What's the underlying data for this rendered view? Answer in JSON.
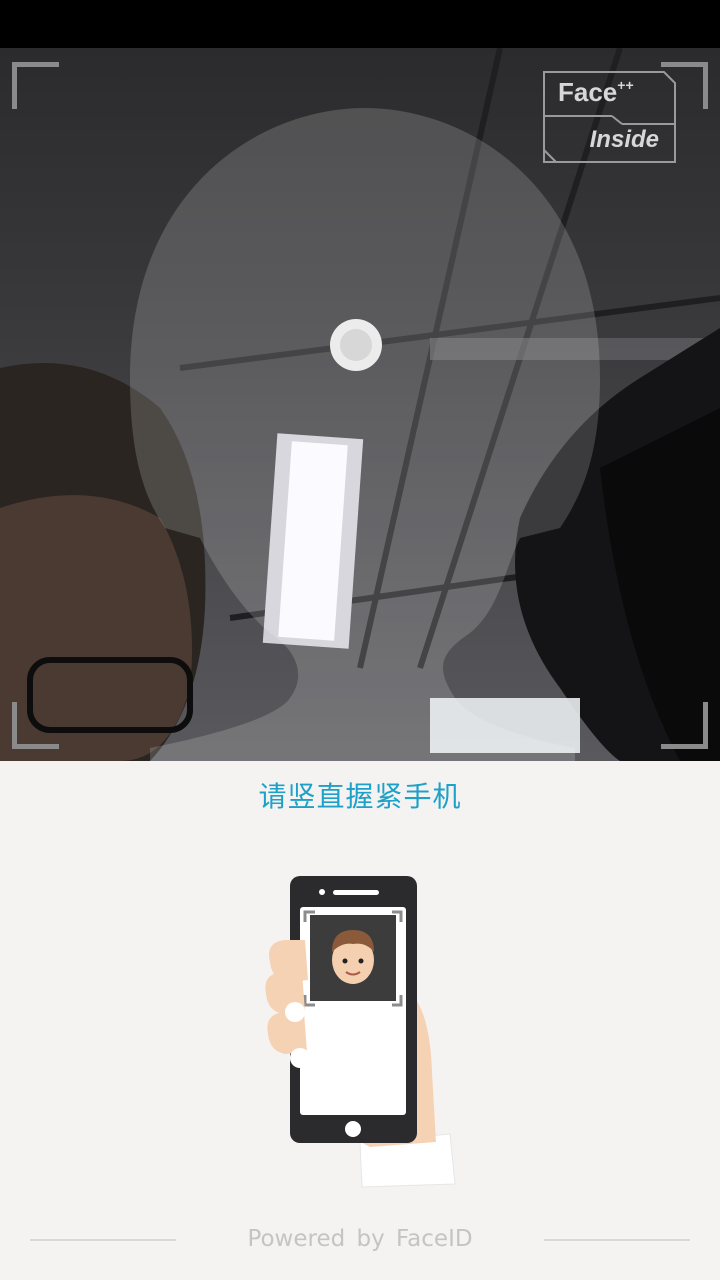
{
  "status_bar": {},
  "camera": {
    "badge": {
      "brand": "Face",
      "sup": "++",
      "sub": "Inside"
    }
  },
  "prompt": {
    "text": "请竖直握紧手机"
  },
  "footer": {
    "text": "Powered by FaceID"
  },
  "colors": {
    "accent": "#1da1c8",
    "background": "#f5f3f1"
  }
}
